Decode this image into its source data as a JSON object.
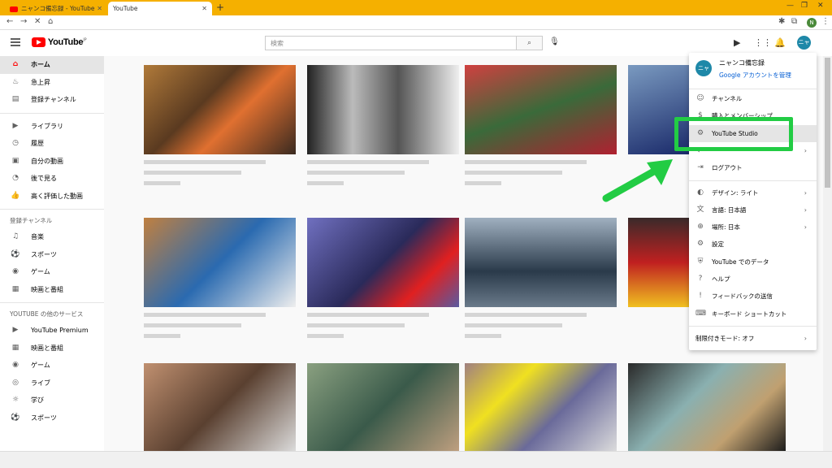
{
  "browser": {
    "tabs": [
      {
        "title": "ニャンコ備忘録 - YouTube"
      },
      {
        "title": "YouTube"
      }
    ],
    "new_tab": "+",
    "profile_initial": "N"
  },
  "masthead": {
    "logo_text": "YouTube",
    "logo_region": "JP",
    "search_placeholder": "検索",
    "avatar_text": "ニャ"
  },
  "sidebar": {
    "main": [
      {
        "label": "ホーム",
        "icon": "home-icon",
        "active": true
      },
      {
        "label": "急上昇",
        "icon": "trending-icon"
      },
      {
        "label": "登録チャンネル",
        "icon": "subscriptions-icon"
      }
    ],
    "library": [
      {
        "label": "ライブラリ",
        "icon": "library-icon"
      },
      {
        "label": "履歴",
        "icon": "history-icon"
      },
      {
        "label": "自分の動画",
        "icon": "my-videos-icon"
      },
      {
        "label": "後で見る",
        "icon": "watch-later-icon"
      },
      {
        "label": "高く評価した動画",
        "icon": "liked-icon"
      }
    ],
    "subs_header": "登録チャンネル",
    "subs": [
      {
        "label": "音楽",
        "icon": "music-icon"
      },
      {
        "label": "スポーツ",
        "icon": "sports-icon"
      },
      {
        "label": "ゲーム",
        "icon": "gaming-icon"
      },
      {
        "label": "映画と番組",
        "icon": "movies-icon"
      }
    ],
    "more_header": "YOUTUBE の他のサービス",
    "more": [
      {
        "label": "YouTube Premium",
        "icon": "premium-icon"
      },
      {
        "label": "映画と番組",
        "icon": "movies-icon"
      },
      {
        "label": "ゲーム",
        "icon": "gaming-icon"
      },
      {
        "label": "ライブ",
        "icon": "live-icon"
      },
      {
        "label": "学び",
        "icon": "learning-icon"
      },
      {
        "label": "スポーツ",
        "icon": "sports-icon"
      }
    ]
  },
  "account_menu": {
    "name": "ニャンコ備忘録",
    "manage_link": "Google アカウントを管理",
    "avatar_text": "ニャ",
    "items": [
      {
        "label": "チャンネル",
        "icon": "channel-icon"
      },
      {
        "label": "購入とメンバーシップ",
        "icon": "purchases-icon"
      },
      {
        "label": "YouTube Studio",
        "icon": "studio-gear-icon",
        "highlighted": true
      },
      {
        "label": "",
        "icon": "switch-account-icon",
        "chevron": true
      },
      {
        "label": "ログアウト",
        "icon": "logout-icon"
      },
      {
        "label": "デザイン: ライト",
        "icon": "theme-icon",
        "chevron": true
      },
      {
        "label": "言語: 日本語",
        "icon": "language-icon",
        "chevron": true
      },
      {
        "label": "場所: 日本",
        "icon": "location-icon",
        "chevron": true
      },
      {
        "label": "設定",
        "icon": "settings-icon"
      },
      {
        "label": "YouTube でのデータ",
        "icon": "data-shield-icon"
      },
      {
        "label": "ヘルプ",
        "icon": "help-icon"
      },
      {
        "label": "フィードバックの送信",
        "icon": "feedback-icon"
      },
      {
        "label": "キーボード ショートカット",
        "icon": "keyboard-icon"
      },
      {
        "label": "制限付きモード: オフ",
        "icon": "",
        "chevron": true
      }
    ]
  },
  "colors": {
    "chrome_tabstrip": "#f5b000",
    "youtube_red": "#ff0000",
    "link_blue": "#065fd4",
    "annotation_green": "#22cc44"
  }
}
